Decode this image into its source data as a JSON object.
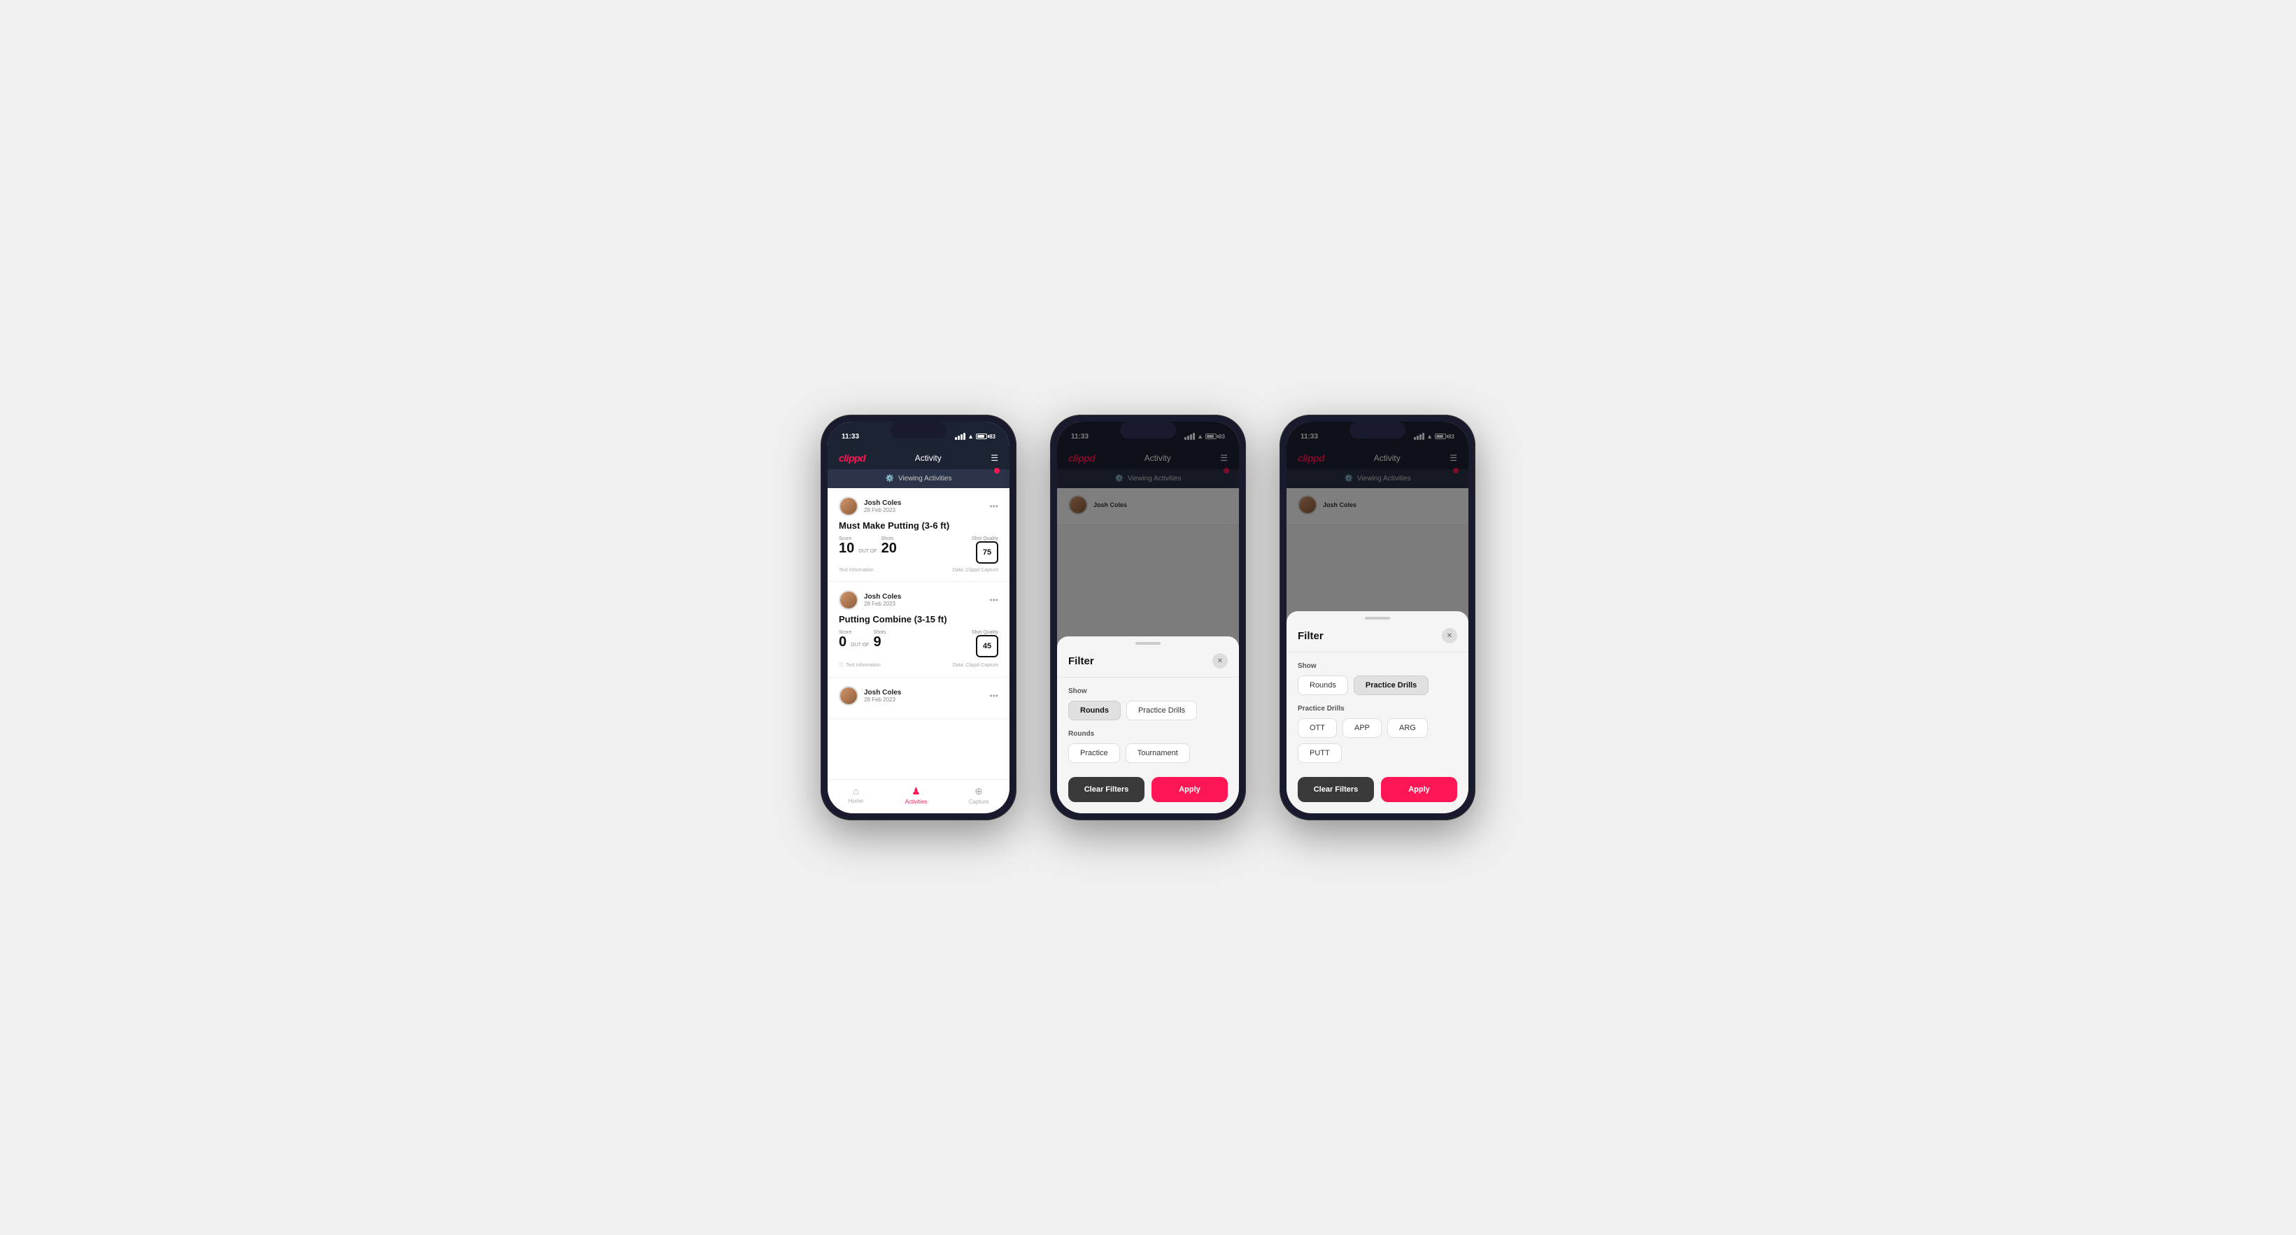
{
  "app": {
    "name": "clippd",
    "header_title": "Activity",
    "menu_label": "☰"
  },
  "status_bar": {
    "time": "11:33",
    "battery_level": "83"
  },
  "viewing_activities": {
    "label": "Viewing Activities"
  },
  "phone1": {
    "activities": [
      {
        "user_name": "Josh Coles",
        "user_date": "28 Feb 2023",
        "title": "Must Make Putting (3-6 ft)",
        "score_label": "Score",
        "score_value": "10",
        "shots_label": "Shots",
        "out_of_label": "OUT OF",
        "shots_value": "20",
        "shot_quality_label": "Shot Quality",
        "shot_quality_value": "75",
        "test_info": "Test Information",
        "data_source": "Data: Clippd Capture"
      },
      {
        "user_name": "Josh Coles",
        "user_date": "28 Feb 2023",
        "title": "Putting Combine (3-15 ft)",
        "score_label": "Score",
        "score_value": "0",
        "shots_label": "Shots",
        "out_of_label": "OUT OF",
        "shots_value": "9",
        "shot_quality_label": "Shot Quality",
        "shot_quality_value": "45",
        "test_info": "Test Information",
        "data_source": "Data: Clippd Capture"
      },
      {
        "user_name": "Josh Coles",
        "user_date": "28 Feb 2023",
        "title": "",
        "score_label": "",
        "score_value": "",
        "shots_label": "",
        "out_of_label": "",
        "shots_value": "",
        "shot_quality_label": "",
        "shot_quality_value": "",
        "test_info": "",
        "data_source": ""
      }
    ],
    "nav": {
      "home": "Home",
      "activities": "Activities",
      "capture": "Capture"
    }
  },
  "filter_modal": {
    "title": "Filter",
    "show_label": "Show",
    "rounds_btn": "Rounds",
    "practice_drills_btn": "Practice Drills",
    "rounds_section_label": "Rounds",
    "practice_btn": "Practice",
    "tournament_btn": "Tournament",
    "clear_filters_btn": "Clear Filters",
    "apply_btn": "Apply"
  },
  "filter_modal2": {
    "title": "Filter",
    "show_label": "Show",
    "rounds_btn": "Rounds",
    "practice_drills_btn": "Practice Drills",
    "practice_drills_section_label": "Practice Drills",
    "ott_btn": "OTT",
    "app_btn": "APP",
    "arg_btn": "ARG",
    "putt_btn": "PUTT",
    "clear_filters_btn": "Clear Filters",
    "apply_btn": "Apply"
  }
}
